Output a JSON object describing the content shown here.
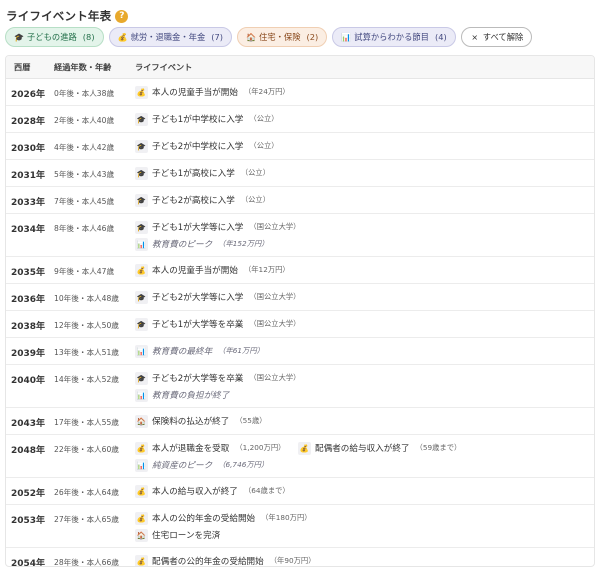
{
  "title": "ライフイベント年表",
  "help_glyph": "?",
  "filters": [
    {
      "label": "子どもの進路",
      "count": "(8)",
      "style": "green",
      "icon": "graduation-cap-icon",
      "glyph": "🎓"
    },
    {
      "label": "就労・退職金・年金",
      "count": "(7)",
      "style": "purple",
      "icon": "coin-bag-icon",
      "glyph": "💰"
    },
    {
      "label": "住宅・保険",
      "count": "(2)",
      "style": "orange",
      "icon": "house-icon",
      "glyph": "🏠"
    },
    {
      "label": "試算からわかる節目",
      "count": "(4)",
      "style": "purple",
      "icon": "chart-icon",
      "glyph": "📊"
    }
  ],
  "clear_button": {
    "glyph": "×",
    "label": "すべて解除"
  },
  "table": {
    "headers": {
      "year": "西暦",
      "age": "経過年数・年齢",
      "event": "ライフイベント"
    },
    "rows": [
      {
        "year": "2026年",
        "age": "0年後・本人38歳",
        "events": [
          {
            "icon": "coin-bag-icon",
            "glyph": "💰",
            "label": "本人の児童手当が開始",
            "note": "（年24万円）"
          }
        ]
      },
      {
        "year": "2028年",
        "age": "2年後・本人40歳",
        "events": [
          {
            "icon": "graduation-cap-icon",
            "glyph": "🎓",
            "label": "子ども1が中学校に入学",
            "note": "（公立）"
          }
        ]
      },
      {
        "year": "2030年",
        "age": "4年後・本人42歳",
        "events": [
          {
            "icon": "graduation-cap-icon",
            "glyph": "🎓",
            "label": "子ども2が中学校に入学",
            "note": "（公立）"
          }
        ]
      },
      {
        "year": "2031年",
        "age": "5年後・本人43歳",
        "events": [
          {
            "icon": "graduation-cap-icon",
            "glyph": "🎓",
            "label": "子ども1が高校に入学",
            "note": "（公立）"
          }
        ]
      },
      {
        "year": "2033年",
        "age": "7年後・本人45歳",
        "events": [
          {
            "icon": "graduation-cap-icon",
            "glyph": "🎓",
            "label": "子ども2が高校に入学",
            "note": "（公立）"
          }
        ]
      },
      {
        "year": "2034年",
        "age": "8年後・本人46歳",
        "events": [
          {
            "icon": "graduation-cap-icon",
            "glyph": "🎓",
            "label": "子ども1が大学等に入学",
            "note": "（国公立大学）"
          },
          {
            "icon": "chart-icon",
            "glyph": "📊",
            "label": "教育費のピーク",
            "note": "（年152万円）",
            "italic": true
          }
        ]
      },
      {
        "year": "2035年",
        "age": "9年後・本人47歳",
        "events": [
          {
            "icon": "coin-bag-icon",
            "glyph": "💰",
            "label": "本人の児童手当が開始",
            "note": "（年12万円）"
          }
        ]
      },
      {
        "year": "2036年",
        "age": "10年後・本人48歳",
        "events": [
          {
            "icon": "graduation-cap-icon",
            "glyph": "🎓",
            "label": "子ども2が大学等に入学",
            "note": "（国公立大学）"
          }
        ]
      },
      {
        "year": "2038年",
        "age": "12年後・本人50歳",
        "events": [
          {
            "icon": "graduation-cap-icon",
            "glyph": "🎓",
            "label": "子ども1が大学等を卒業",
            "note": "（国公立大学）"
          }
        ]
      },
      {
        "year": "2039年",
        "age": "13年後・本人51歳",
        "events": [
          {
            "icon": "chart-icon",
            "glyph": "📊",
            "label": "教育費の最終年",
            "note": "（年61万円）",
            "italic": true
          }
        ]
      },
      {
        "year": "2040年",
        "age": "14年後・本人52歳",
        "events": [
          {
            "icon": "graduation-cap-icon",
            "glyph": "🎓",
            "label": "子ども2が大学等を卒業",
            "note": "（国公立大学）"
          },
          {
            "icon": "chart-icon",
            "glyph": "📊",
            "label": "教育費の負担が終了",
            "note": "",
            "italic": true
          }
        ]
      },
      {
        "year": "2043年",
        "age": "17年後・本人55歳",
        "events": [
          {
            "icon": "house-icon",
            "glyph": "🏠",
            "label": "保険料の払込が終了",
            "note": "（55歳）"
          }
        ]
      },
      {
        "year": "2048年",
        "age": "22年後・本人60歳",
        "events": [
          {
            "icon": "coin-bag-icon",
            "glyph": "💰",
            "label": "本人が退職金を受取",
            "note": "（1,200万円）"
          },
          {
            "icon": "coin-bag-icon",
            "glyph": "💰",
            "label": "配偶者の給与収入が終了",
            "note": "（59歳まで）",
            "inline": true
          },
          {
            "icon": "chart-icon",
            "glyph": "📊",
            "label": "純資産のピーク",
            "note": "（6,746万円）",
            "italic": true
          }
        ]
      },
      {
        "year": "2052年",
        "age": "26年後・本人64歳",
        "events": [
          {
            "icon": "coin-bag-icon",
            "glyph": "💰",
            "label": "本人の給与収入が終了",
            "note": "（64歳まで）"
          }
        ]
      },
      {
        "year": "2053年",
        "age": "27年後・本人65歳",
        "events": [
          {
            "icon": "coin-bag-icon",
            "glyph": "💰",
            "label": "本人の公的年金の受給開始",
            "note": "（年180万円）"
          },
          {
            "icon": "house-icon",
            "glyph": "🏠",
            "label": "住宅ローンを完済",
            "note": ""
          }
        ]
      },
      {
        "year": "2054年",
        "age": "28年後・本人66歳",
        "events": [
          {
            "icon": "coin-bag-icon",
            "glyph": "💰",
            "label": "配偶者の公的年金の受給開始",
            "note": "（年90万円）"
          }
        ]
      }
    ]
  }
}
